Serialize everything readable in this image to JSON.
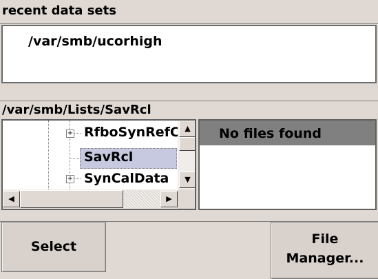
{
  "recent": {
    "title": "recent data sets",
    "items": [
      "/var/smb/ucorhigh"
    ]
  },
  "path": "/var/smb/Lists/SavRcl",
  "tree": {
    "items": [
      {
        "label": "RfboSynRefC",
        "expander": "+"
      },
      {
        "label": "SavRcl",
        "selected": true
      },
      {
        "label": "SynCalData",
        "expander": "+"
      }
    ]
  },
  "files": {
    "empty_text": "No files found"
  },
  "buttons": {
    "select": "Select",
    "file_manager_line1": "File",
    "file_manager_line2": "Manager..."
  },
  "scroll_icons": {
    "up": "▲",
    "down": "▼",
    "left": "◀",
    "right": "▶"
  }
}
